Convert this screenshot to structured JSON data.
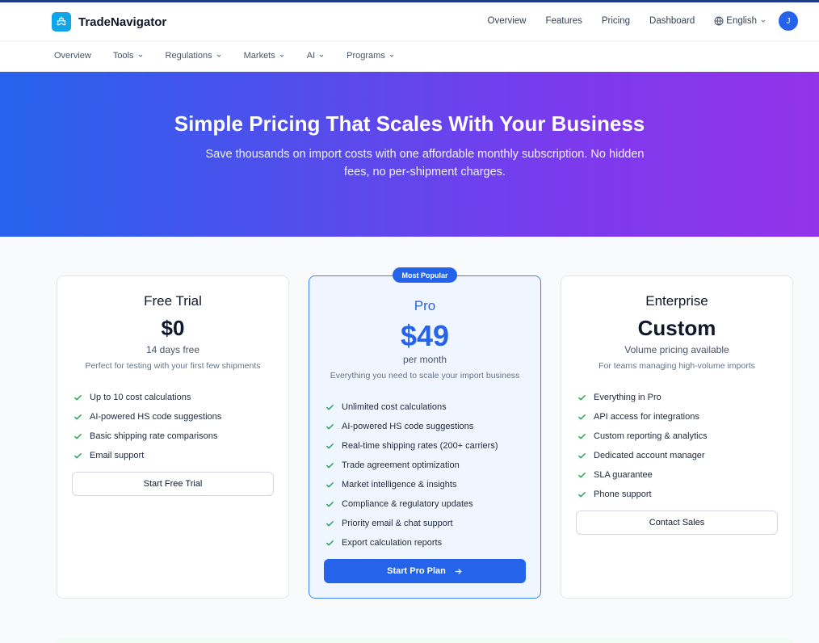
{
  "header": {
    "brand": "TradeNavigator",
    "nav": [
      "Overview",
      "Features",
      "Pricing",
      "Dashboard"
    ],
    "language": "English",
    "avatar_initial": "J"
  },
  "subnav": {
    "items": [
      "Overview",
      "Tools",
      "Regulations",
      "Markets",
      "AI",
      "Programs"
    ]
  },
  "hero": {
    "title": "Simple Pricing That Scales With Your Business",
    "subtitle": "Save thousands on import costs with one affordable monthly subscription. No hidden fees, no per-shipment charges."
  },
  "plans": [
    {
      "name": "Free Trial",
      "price": "$0",
      "period": "14 days free",
      "description": "Perfect for testing with your first few shipments",
      "features": [
        "Up to 10 cost calculations",
        "AI-powered HS code suggestions",
        "Basic shipping rate comparisons",
        "Email support"
      ],
      "cta": "Start Free Trial"
    },
    {
      "name": "Pro",
      "badge": "Most Popular",
      "price": "$49",
      "period": "per month",
      "description": "Everything you need to scale your import business",
      "features": [
        "Unlimited cost calculations",
        "AI-powered HS code suggestions",
        "Real-time shipping rates (200+ carriers)",
        "Trade agreement optimization",
        "Market intelligence & insights",
        "Compliance & regulatory updates",
        "Priority email & chat support",
        "Export calculation reports"
      ],
      "cta": "Start Pro Plan"
    },
    {
      "name": "Enterprise",
      "price": "Custom",
      "period": "Volume pricing available",
      "description": "For teams managing high-volume imports",
      "features": [
        "Everything in Pro",
        "API access for integrations",
        "Custom reporting & analytics",
        "Dedicated account manager",
        "SLA guarantee",
        "Phone support"
      ],
      "cta": "Contact Sales"
    }
  ],
  "colors": {
    "primary": "#2563eb",
    "check": "#16a34a",
    "gradient_start": "#2563eb",
    "gradient_end": "#9333ea"
  }
}
